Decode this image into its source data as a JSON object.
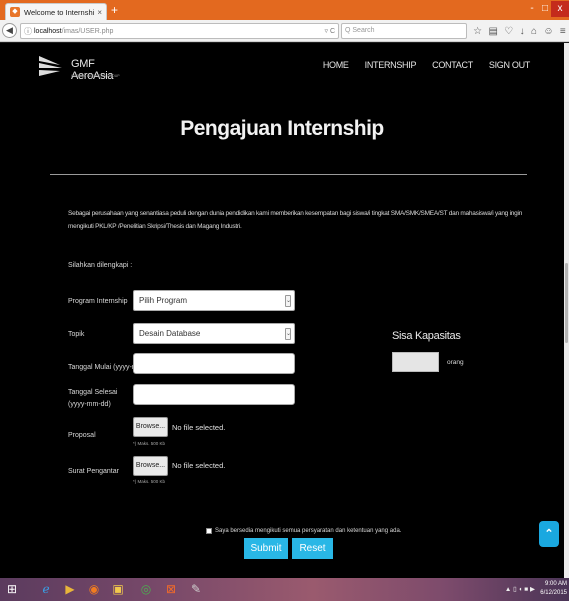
{
  "browser": {
    "tab_title": "Welcome to Internship Ma...",
    "tab_close": "×",
    "new_tab": "+",
    "win_min": "-",
    "win_max": "□",
    "win_close": "x",
    "url_host": "localhost",
    "url_path": "/imas/USER.php",
    "url_reload": "▿ C",
    "search_placeholder": "Q Search",
    "toolbar_icons": [
      "star-icon",
      "reading-list-icon",
      "pocket-icon",
      "download-icon",
      "home-icon",
      "sync-icon",
      "menu-icon"
    ]
  },
  "site": {
    "logo_text": "GMF AeroAsia",
    "logo_sub": "GARUDA INDONESIA GROUP",
    "nav": [
      "HOME",
      "INTERNSHIP",
      "CONTACT",
      "SIGN OUT"
    ]
  },
  "page": {
    "title": "Pengajuan Internship",
    "intro": "Sebagai perusahaan yang senantiasa peduli dengan dunia pendidikan kami memberikan kesempatan bagi siswa/i tingkat SMA/SMK/SMEA/ST dan mahasiswa/i yang ingin mengikuti PKL/KP /Penelitian Skripsi/Thesis dan Magang Industri.",
    "fill_note": "Silahkan dilengkapi :"
  },
  "form": {
    "program_label": "Program Internship",
    "program_value": "Pilih Program",
    "topik_label": "Topik",
    "topik_value": "Desain Database",
    "mulai_label": "Tanggal Mulai (yyyy-mm-dd)",
    "selesai_label": "Tanggal Selesai (yyyy-mm-dd)",
    "proposal_label": "Proposal",
    "pengantar_label": "Surat Pengantar",
    "browse_label": "Browse...",
    "no_file": "No file selected.",
    "maks_note": "*) Maks. 500 Kb",
    "sisa_title": "Sisa Kapasitas",
    "sisa_unit": "orang",
    "agree_text": "Saya bersedia mengikuti semua persyaratan dan ketentuan yang ada.",
    "submit_label": "Submit",
    "reset_label": "Reset"
  },
  "taskbar": {
    "tray": "▲ ▯ ◖ ■ ▶",
    "time": "9:00 AM",
    "date": "6/12/2015"
  },
  "colors": {
    "accent": "#29b7e6",
    "titlebar": "#e3691f",
    "page_bg": "#000000"
  }
}
